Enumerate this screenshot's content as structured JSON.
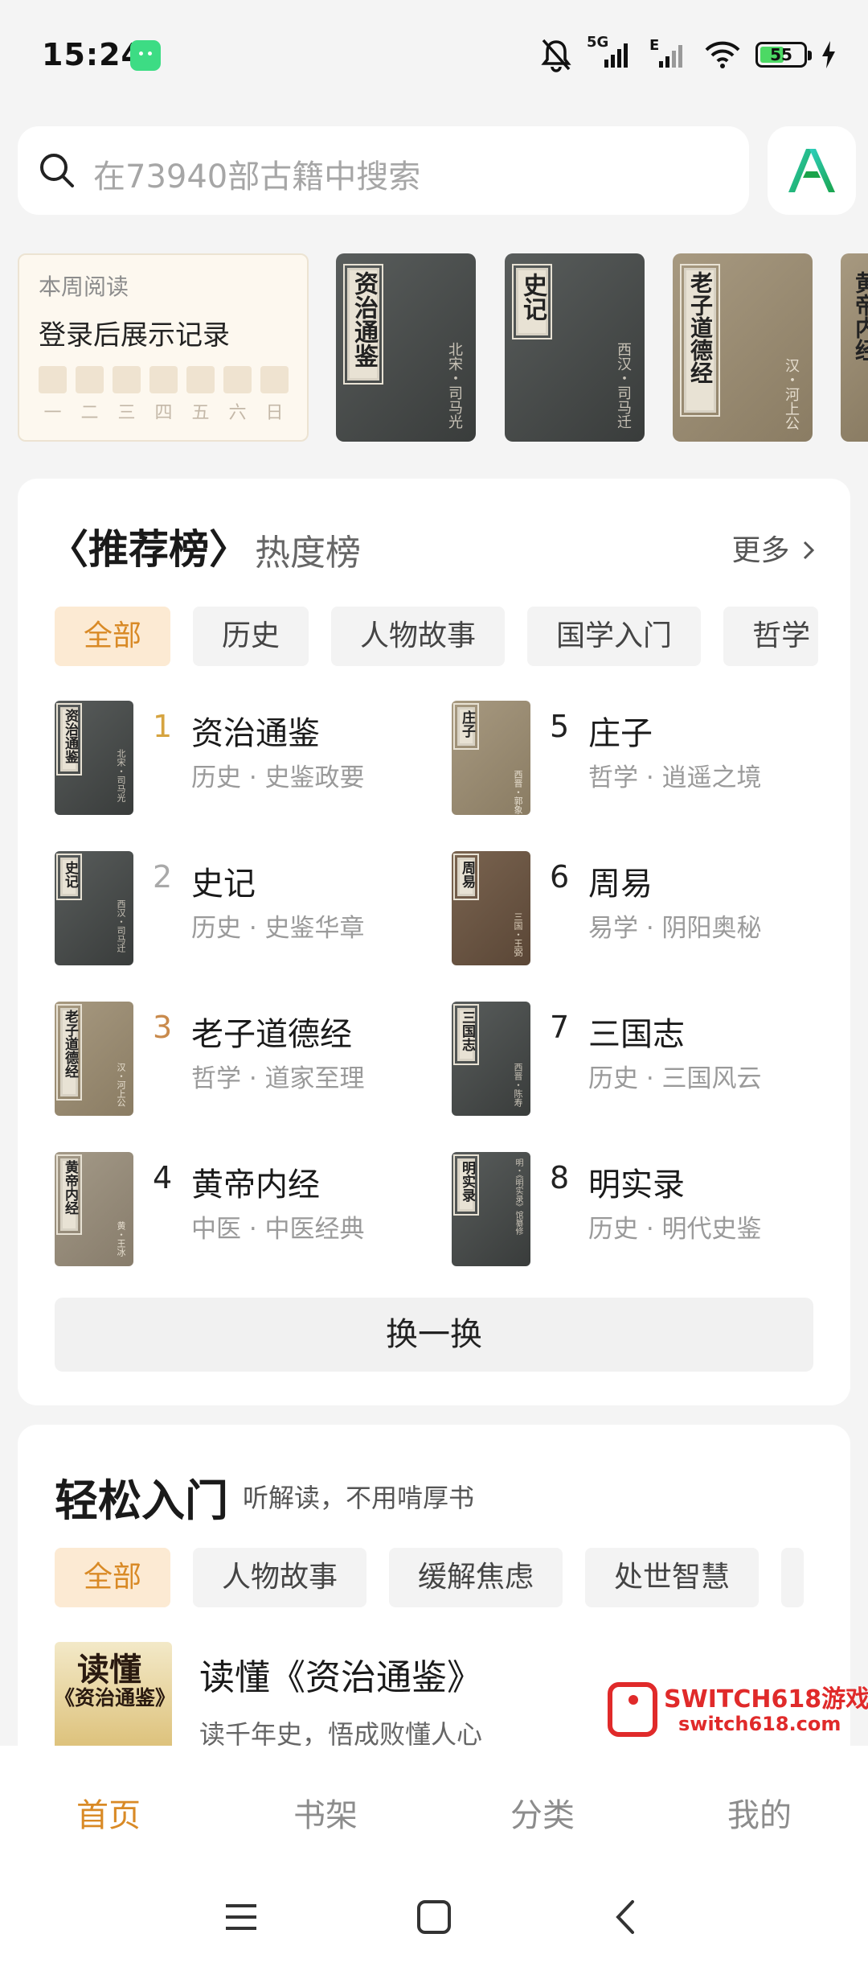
{
  "status": {
    "time": "15:24",
    "network": "5G",
    "battery": "55",
    "battery_level": 0.55
  },
  "search": {
    "placeholder": "在73940部古籍中搜索"
  },
  "weekly_reading": {
    "label": "本周阅读",
    "message": "登录后展示记录",
    "days": [
      "一",
      "二",
      "三",
      "四",
      "五",
      "六",
      "日"
    ]
  },
  "recent_books": [
    {
      "title": "资治通鉴",
      "author": "北宋・司马光"
    },
    {
      "title": "史记",
      "author": "西汉・司马迁"
    },
    {
      "title": "老子道德经",
      "author": "汉・河上公"
    },
    {
      "title": "黄帝内经",
      "author": ""
    }
  ],
  "ranking": {
    "tab_recommend": "〈推荐榜〉",
    "tab_hot": "热度榜",
    "more": "更多",
    "chips": [
      "全部",
      "历史",
      "人物故事",
      "国学入门",
      "哲学"
    ],
    "items": [
      {
        "rank": "1",
        "title": "资治通鉴",
        "subtitle": "历史 · 史鉴政要",
        "cover": "资治通鉴",
        "author": "北宋・司马光"
      },
      {
        "rank": "2",
        "title": "史记",
        "subtitle": "历史 · 史鉴华章",
        "cover": "史记",
        "author": "西汉・司马迁"
      },
      {
        "rank": "3",
        "title": "老子道德经",
        "subtitle": "哲学 · 道家至理",
        "cover": "老子道德经",
        "author": "汉・河上公"
      },
      {
        "rank": "4",
        "title": "黄帝内经",
        "subtitle": "中医 · 中医经典",
        "cover": "黄帝内经",
        "author": "黄・王冰"
      },
      {
        "rank": "5",
        "title": "庄子",
        "subtitle": "哲学 · 逍遥之境",
        "cover": "庄子",
        "author": "西晋・郭象"
      },
      {
        "rank": "6",
        "title": "周易",
        "subtitle": "易学 · 阴阳奥秘",
        "cover": "周易",
        "author": "三国・王弼"
      },
      {
        "rank": "7",
        "title": "三国志",
        "subtitle": "历史 · 三国风云",
        "cover": "三国志",
        "author": "西晋・陈寿"
      },
      {
        "rank": "8",
        "title": "明实录",
        "subtitle": "历史 · 明代史鉴",
        "cover": "明实录",
        "author": "明・《明实录》馆纂修"
      }
    ],
    "swap": "换一换"
  },
  "intro": {
    "title": "轻松入门",
    "subtitle": "听解读，不用啃厚书",
    "chips": [
      "全部",
      "人物故事",
      "缓解焦虑",
      "处世智慧"
    ],
    "book_title": "读懂《资治通鉴》",
    "book_desc": "读千年史，悟成败懂人心",
    "cover_line1": "读懂",
    "cover_line2": "《资治通鉴》"
  },
  "watermark": {
    "line1": "SWITCH618游戏",
    "line2": "switch618.com"
  },
  "nav": {
    "home": "首页",
    "shelf": "书架",
    "category": "分类",
    "mine": "我的"
  },
  "colors": {
    "accent": "#d98a26",
    "chip_active_bg": "#fcead3",
    "page_bg": "#f4f4f4"
  }
}
